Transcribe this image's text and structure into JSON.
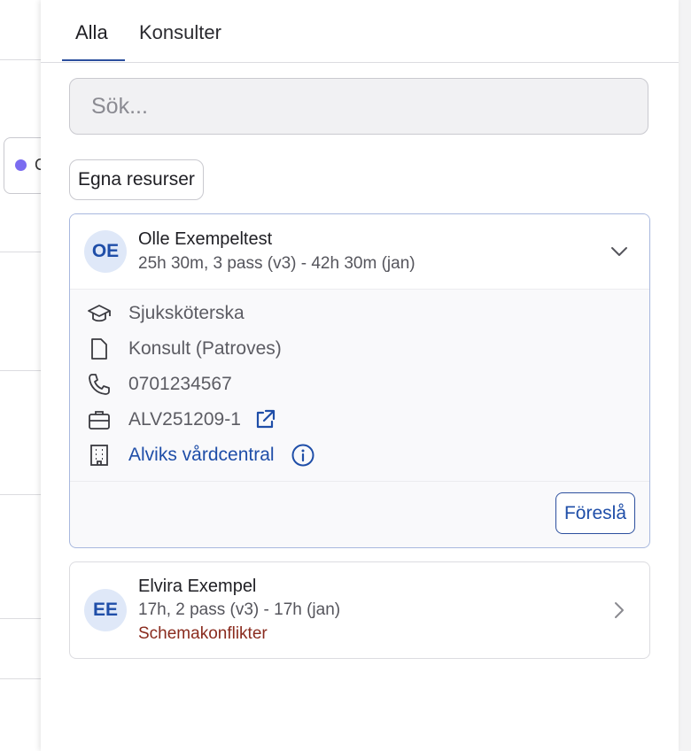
{
  "background": {
    "chip_text": "C"
  },
  "tabs": [
    {
      "label": "Alla",
      "active": true
    },
    {
      "label": "Konsulter",
      "active": false
    }
  ],
  "search": {
    "placeholder": "Sök..."
  },
  "filter_button": {
    "label": "Egna resurser"
  },
  "cards": [
    {
      "initials": "OE",
      "name": "Olle Exempeltest",
      "summary": "25h 30m, 3 pass (v3) - 42h 30m (jan)",
      "expanded": true,
      "details": {
        "role": "Sjuksköterska",
        "employment": "Konsult (Patroves)",
        "phone": "0701234567",
        "assignment": "ALV251209-1",
        "unit": "Alviks vårdcentral"
      },
      "action_label": "Föreslå"
    },
    {
      "initials": "EE",
      "name": "Elvira Exempel",
      "summary": "17h, 2 pass (v3) - 17h (jan)",
      "warning": "Schemakonflikter",
      "expanded": false
    }
  ],
  "colors": {
    "accent": "#2c4f9e",
    "link": "#1f4ea8",
    "warning": "#8a2b1e",
    "avatar_bg": "#dfe8f8"
  }
}
